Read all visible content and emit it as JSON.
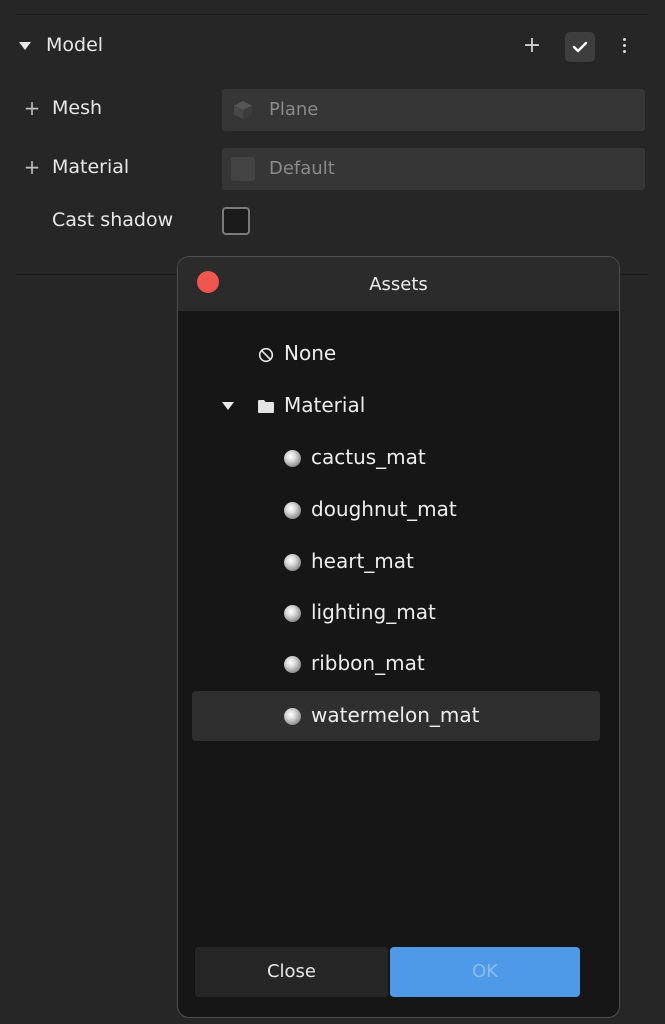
{
  "section": {
    "title": "Model"
  },
  "properties": {
    "mesh": {
      "label": "Mesh",
      "value": "Plane"
    },
    "material": {
      "label": "Material",
      "value": "Default"
    },
    "cast_shadow": {
      "label": "Cast shadow",
      "checked": false
    }
  },
  "header_icons": {
    "add": "plus-icon",
    "enabled": "checkmark-icon",
    "more": "more-vertical-icon"
  },
  "dialog": {
    "title": "Assets",
    "none_label": "None",
    "folder_label": "Material",
    "items": [
      "cactus_mat",
      "doughnut_mat",
      "heart_mat",
      "lighting_mat",
      "ribbon_mat",
      "watermelon_mat"
    ],
    "selected": "watermelon_mat",
    "close_label": "Close",
    "ok_label": "OK"
  },
  "colors": {
    "panel_bg": "#262626",
    "dialog_bg": "#161616",
    "accent": "#4f9ae8",
    "close_dot": "#f0564d"
  }
}
